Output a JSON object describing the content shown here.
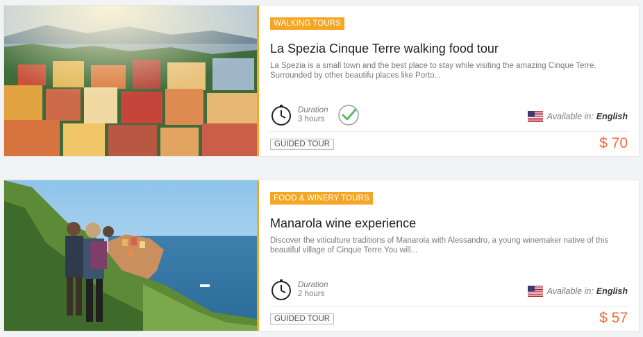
{
  "tours": [
    {
      "category": "WALKING TOURS",
      "title": "La Spezia Cinque Terre walking food tour",
      "description": "La Spezia is a small town and the best place to stay while visiting the amazing Cinque Terre. Surrounded by other beautifu places like Porto...",
      "duration_label": "Duration",
      "duration_value": "3 hours",
      "available_label": "Available in:",
      "language": "English",
      "tour_type": "GUIDED TOUR",
      "price": "$ 70",
      "icons": [
        "clock-icon",
        "check-circle-icon",
        "us-flag-icon"
      ]
    },
    {
      "category": "FOOD & WINERY TOURS",
      "title": "Manarola wine experience",
      "description": "Discover the viticulture traditions of Manarola with Alessandro, a young winemaker native of this beautiful village of Cinque Terre.You will...",
      "duration_label": "Duration",
      "duration_value": "2 hours",
      "available_label": "Available in:",
      "language": "English",
      "tour_type": "GUIDED TOUR",
      "price": "$ 57",
      "icons": [
        "clock-icon",
        "us-flag-icon"
      ]
    }
  ],
  "colors": {
    "accent": "#f5a623",
    "price": "#f26b3a",
    "check": "#5cb85c"
  }
}
